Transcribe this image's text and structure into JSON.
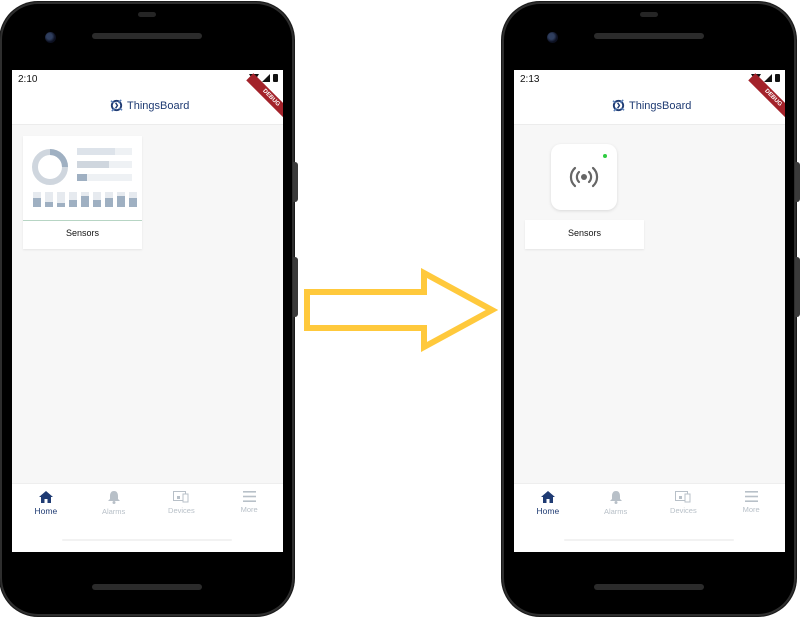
{
  "before": {
    "status_time": "2:10",
    "app_title": "ThingsBoard",
    "debug_banner": "DEBUG",
    "card_label": "Sensors",
    "nav": [
      {
        "label": "Home",
        "icon": "home-icon",
        "active": true
      },
      {
        "label": "Alarms",
        "icon": "bell-icon",
        "active": false
      },
      {
        "label": "Devices",
        "icon": "devices-icon",
        "active": false
      },
      {
        "label": "More",
        "icon": "menu-icon",
        "active": false
      }
    ]
  },
  "after": {
    "status_time": "2:13",
    "app_title": "ThingsBoard",
    "debug_banner": "DEBUG",
    "card_label": "Sensors",
    "device_icon": "sensors-icon",
    "online_color": "#2ecc40",
    "nav": [
      {
        "label": "Home",
        "icon": "home-icon",
        "active": true
      },
      {
        "label": "Alarms",
        "icon": "bell-icon",
        "active": false
      },
      {
        "label": "Devices",
        "icon": "devices-icon",
        "active": false
      },
      {
        "label": "More",
        "icon": "menu-icon",
        "active": false
      }
    ]
  },
  "colors": {
    "brand": "#1f3b73",
    "arrow": "#ffc93c",
    "nav_inactive": "#b8c0c8",
    "debug_ribbon": "#a3222a"
  }
}
